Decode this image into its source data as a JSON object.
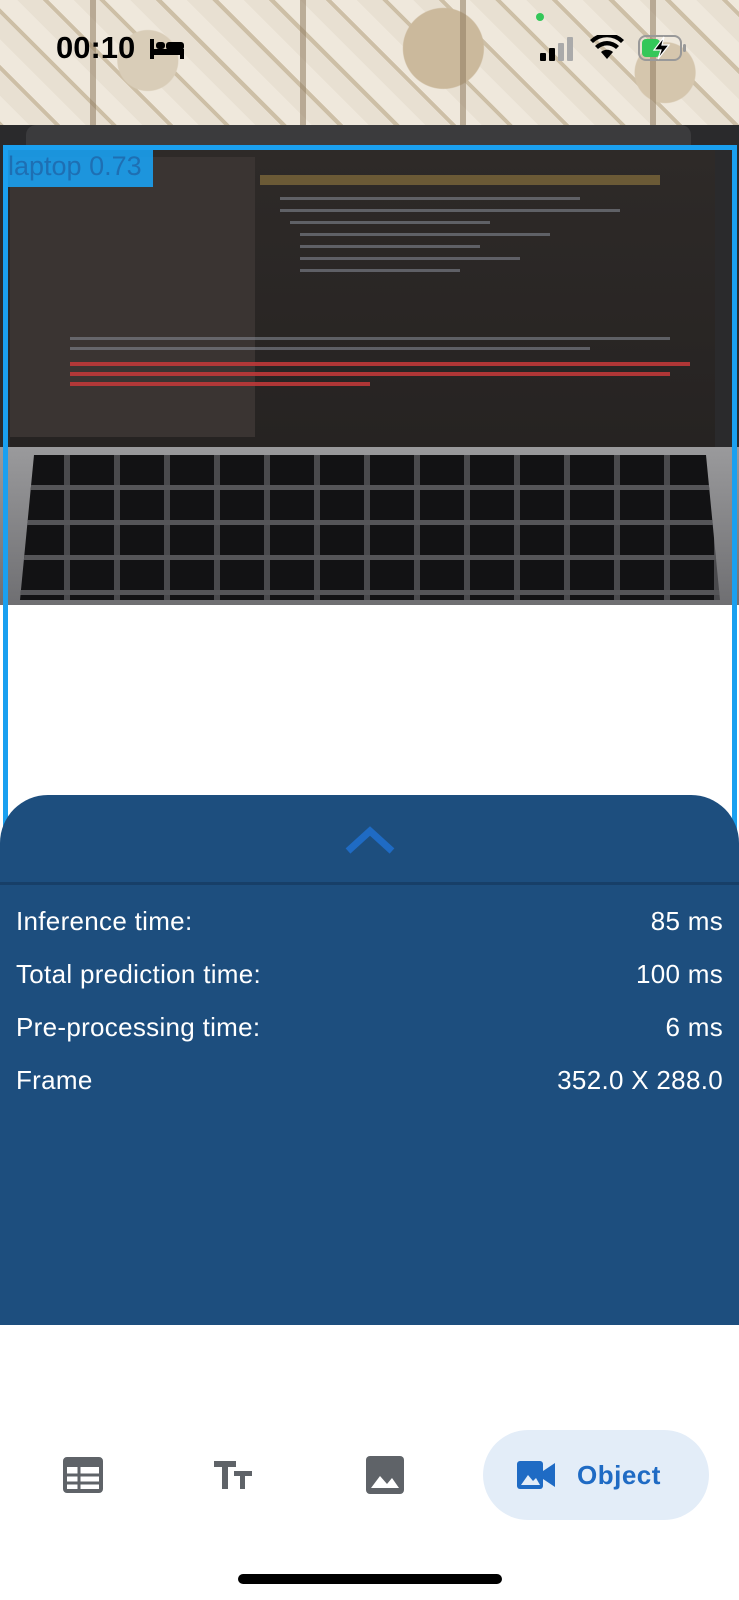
{
  "status_bar": {
    "time": "00:10"
  },
  "detection": {
    "label": "laptop 0.73"
  },
  "stats": [
    {
      "label": "Inference time:",
      "value": "85 ms"
    },
    {
      "label": "Total prediction time:",
      "value": "100 ms"
    },
    {
      "label": "Pre-processing time:",
      "value": "6 ms"
    },
    {
      "label": "Frame",
      "value": "352.0 X 288.0"
    }
  ],
  "bottom_nav": {
    "items": [
      {
        "icon": "table-icon",
        "label": ""
      },
      {
        "icon": "text-format-icon",
        "label": ""
      },
      {
        "icon": "image-icon",
        "label": ""
      },
      {
        "icon": "videocam-icon",
        "label": "Object"
      }
    ],
    "active_index": 3
  },
  "colors": {
    "accent": "#1f6bc4",
    "sheet": "#1d4e7e",
    "detection_box": "#1aa0f0",
    "active_pill": "#e3edf8"
  }
}
